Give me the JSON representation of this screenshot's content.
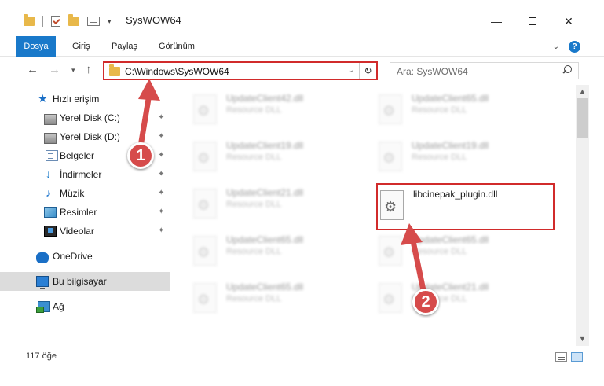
{
  "window": {
    "title": "SysWOW64",
    "minimize_glyph": "—",
    "close_glyph": "✕"
  },
  "ribbon": {
    "tabs": [
      {
        "label": "Dosya",
        "active": true
      },
      {
        "label": "Giriş"
      },
      {
        "label": "Paylaş"
      },
      {
        "label": "Görünüm"
      }
    ],
    "help_glyph": "?"
  },
  "nav": {
    "back_glyph": "←",
    "forward_glyph": "→",
    "recent_glyph": "▾",
    "up_glyph": "↑",
    "address": "C:\\Windows\\SysWOW64",
    "refresh_glyph": "↻",
    "search_placeholder": "Ara: SysWOW64"
  },
  "sidebar": {
    "items": [
      {
        "label": "Hızlı erişim",
        "icon": "star-icon"
      },
      {
        "label": "Yerel Disk (C:)",
        "icon": "drive-icon",
        "pinned": true
      },
      {
        "label": "Yerel Disk (D:)",
        "icon": "drive-icon",
        "pinned": true
      },
      {
        "label": "Belgeler",
        "icon": "documents-icon",
        "pinned": true
      },
      {
        "label": "İndirmeler",
        "icon": "downloads-icon",
        "pinned": true
      },
      {
        "label": "Müzik",
        "icon": "music-icon",
        "pinned": true
      },
      {
        "label": "Resimler",
        "icon": "pictures-icon",
        "pinned": true
      },
      {
        "label": "Videolar",
        "icon": "videos-icon",
        "pinned": true
      },
      {
        "label": "OneDrive",
        "icon": "onedrive-icon"
      },
      {
        "label": "Bu bilgisayar",
        "icon": "computer-icon",
        "selected": true
      },
      {
        "label": "Ağ",
        "icon": "network-icon"
      }
    ],
    "pin_glyph": "📌"
  },
  "files": [
    {
      "name": "UpdateClient42.dll",
      "type": "Resource DLL",
      "blurred": true
    },
    {
      "name": "UpdateClient65.dll",
      "type": "Resource DLL",
      "blurred": true
    },
    {
      "name": "UpdateClient19.dll",
      "type": "Resource DLL",
      "blurred": true
    },
    {
      "name": "UpdateClient19.dll",
      "type": "Resource DLL",
      "blurred": true
    },
    {
      "name": "UpdateClient21.dll",
      "type": "Resource DLL",
      "blurred": true
    },
    {
      "name": "libcinepak_plugin.dll",
      "type": "",
      "blurred": false
    },
    {
      "name": "UpdateClient65.dll",
      "type": "Resource DLL",
      "blurred": true
    },
    {
      "name": "UpdateClient65.dll",
      "type": "Resource DLL",
      "blurred": true
    },
    {
      "name": "UpdateClient65.dll",
      "type": "Resource DLL",
      "blurred": true
    },
    {
      "name": "UpdateClient21.dll",
      "type": "Resource DLL",
      "blurred": true
    }
  ],
  "scrollbar": {
    "up_glyph": "▲",
    "down_glyph": "▼"
  },
  "status": {
    "item_count": "117 öğe"
  },
  "annotations": {
    "step1": "1",
    "step2": "2",
    "color": "#d64b4b"
  }
}
